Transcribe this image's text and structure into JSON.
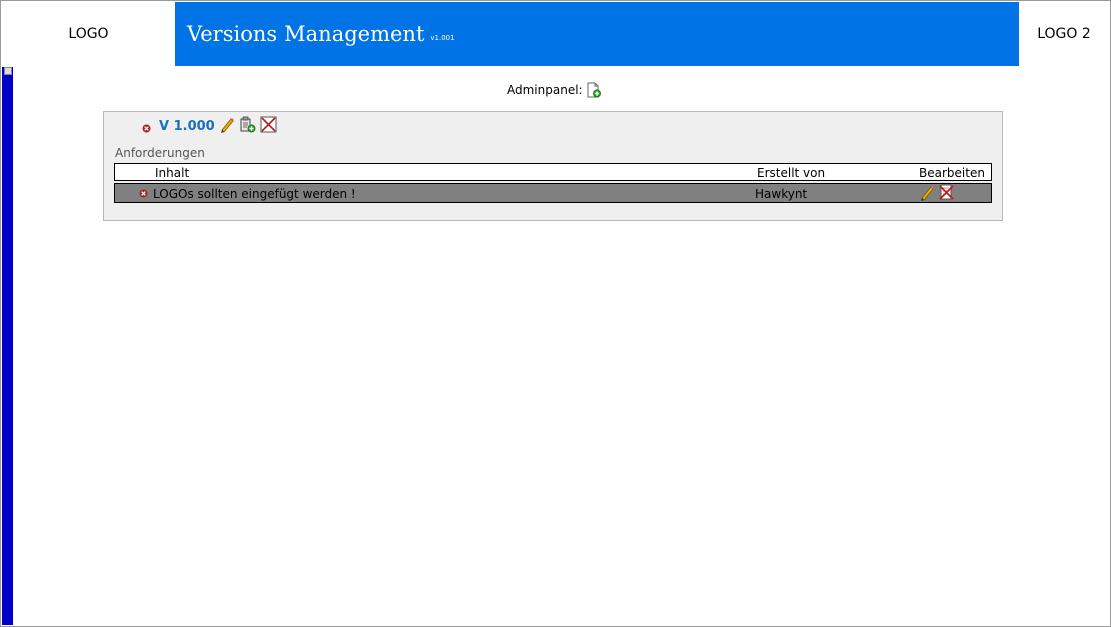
{
  "header": {
    "logo_left": "LOGO",
    "title_part1": "Versions",
    "title_part2": "Management",
    "version": "v1.001",
    "logo_right": "LOGO 2",
    "accent_color": "#0073e6"
  },
  "adminpanel": {
    "label": "Adminpanel:",
    "add_icon": "new-document-icon"
  },
  "version_block": {
    "label": "V 1.000",
    "section_label": "Anforderungen",
    "table": {
      "columns": [
        "Inhalt",
        "Erstellt von",
        "Bearbeiten"
      ],
      "rows": [
        {
          "content": "LOGOs sollten eingefügt werden !",
          "created_by": "Hawkynt"
        }
      ]
    }
  }
}
